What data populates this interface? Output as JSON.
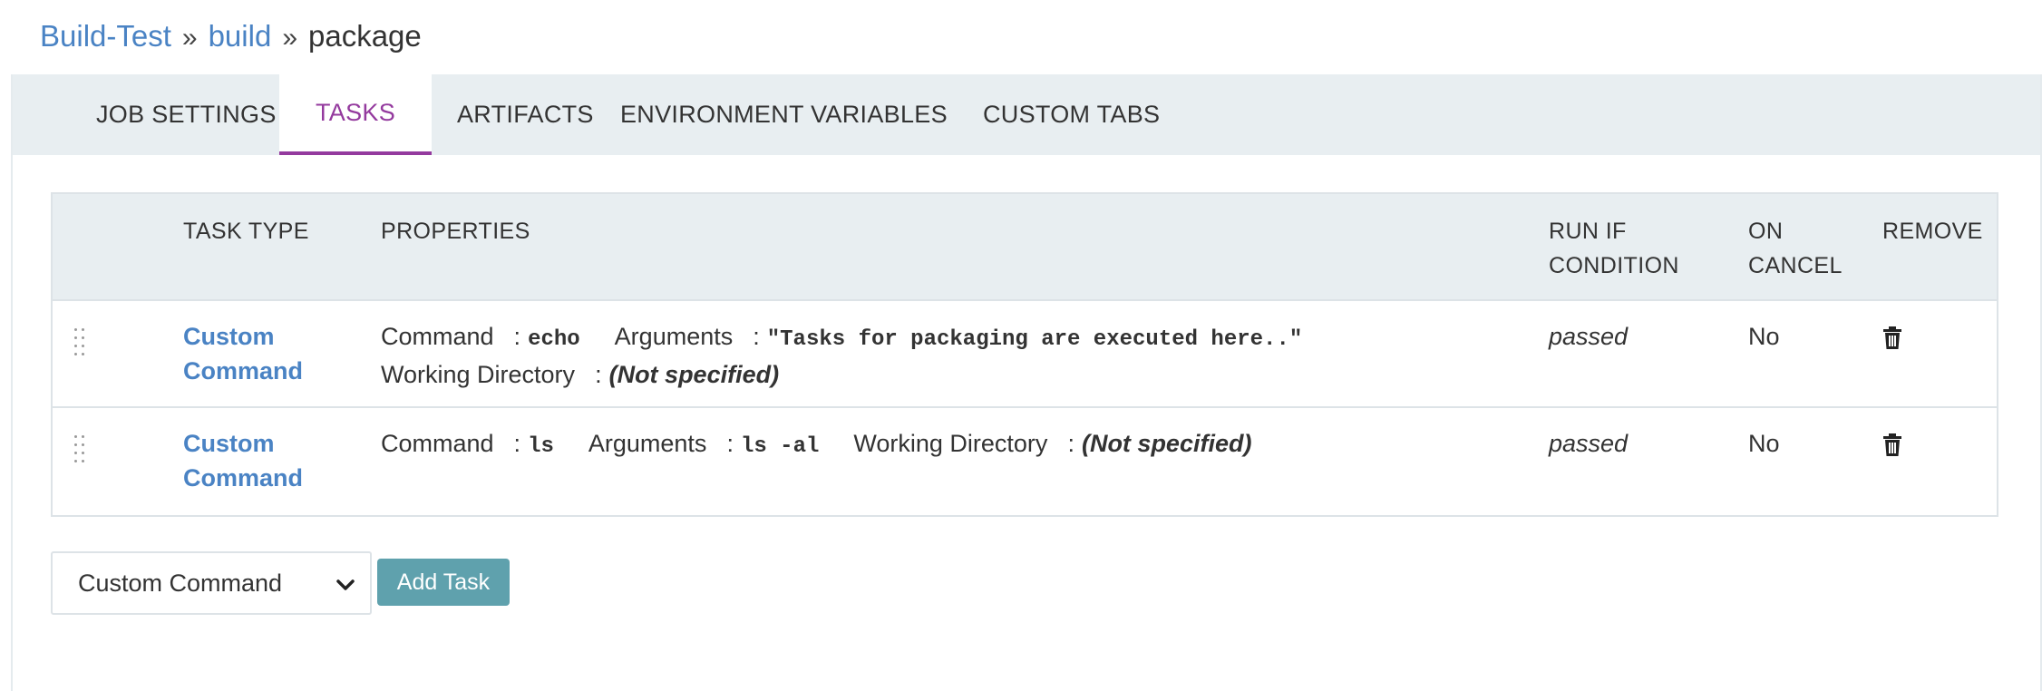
{
  "breadcrumb": {
    "pipeline": "Build-Test",
    "stage": "build",
    "job": "package",
    "separator": "»"
  },
  "tabs": [
    {
      "label": "JOB SETTINGS",
      "active": false
    },
    {
      "label": "TASKS",
      "active": true
    },
    {
      "label": "ARTIFACTS",
      "active": false
    },
    {
      "label": "ENVIRONMENT VARIABLES",
      "active": false
    },
    {
      "label": "CUSTOM TABS",
      "active": false
    }
  ],
  "table": {
    "headers": {
      "task_type": "TASK TYPE",
      "properties": "PROPERTIES",
      "run_if_line1": "RUN IF",
      "run_if_line2": "CONDITION",
      "on_cancel_line1": "ON",
      "on_cancel_line2": "CANCEL",
      "remove": "REMOVE"
    },
    "rows": [
      {
        "type_line1": "Custom",
        "type_line2": "Command",
        "command_key": "Command",
        "command_value": "echo",
        "arguments_key": "Arguments",
        "arguments_value": "\"Tasks for packaging are executed here..\"",
        "workdir_key": "Working Directory",
        "workdir_value": "(Not specified)",
        "run_if": "passed",
        "on_cancel": "No"
      },
      {
        "type_line1": "Custom",
        "type_line2": "Command",
        "command_key": "Command",
        "command_value": "ls",
        "arguments_key": "Arguments",
        "arguments_value": "ls -al",
        "workdir_key": "Working Directory",
        "workdir_value": "(Not specified)",
        "run_if": "passed",
        "on_cancel": "No"
      }
    ]
  },
  "add_task": {
    "selected_type": "Custom Command",
    "button_label": "Add Task"
  },
  "colors": {
    "link": "#4a83c4",
    "active_tab": "#943a9e",
    "button": "#5fa1ad",
    "header_bg": "#e8eef1"
  },
  "icons": {
    "remove": "trash-icon",
    "drag": "drag-handle-icon",
    "dropdown": "chevron-down-icon"
  }
}
